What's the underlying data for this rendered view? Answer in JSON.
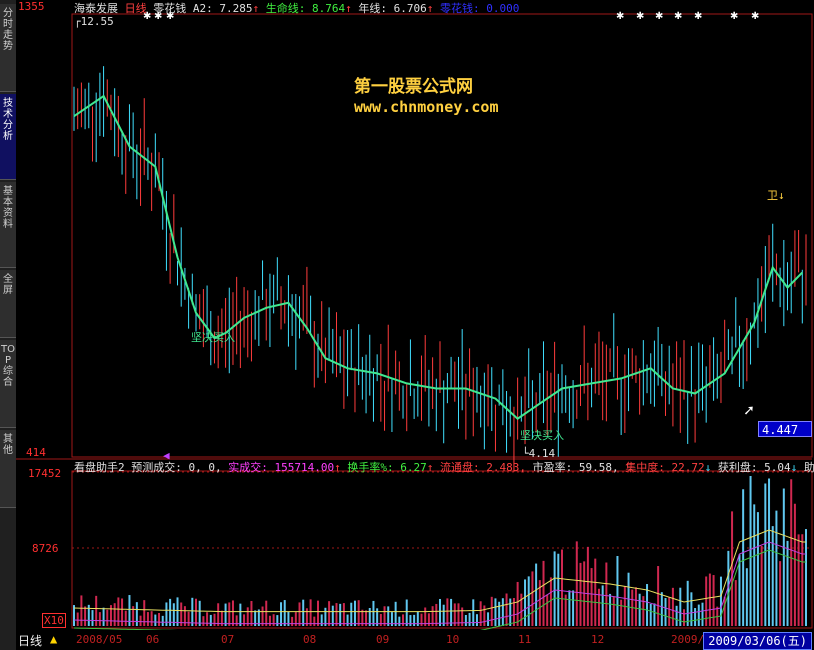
{
  "sidebar": {
    "tabs": [
      {
        "label": "分时走势",
        "active": false
      },
      {
        "label": "技术分析",
        "active": true
      },
      {
        "label": "基本资料",
        "active": false
      },
      {
        "label": "全屏",
        "active": false
      },
      {
        "label": "TOP综合",
        "active": false
      },
      {
        "label": "其他",
        "active": false
      }
    ]
  },
  "header": {
    "stock_name": "海泰发展",
    "period": "日线",
    "indicator": "零花钱",
    "a2_label": "A2:",
    "a2_value": "7.285",
    "life_label": "生命线:",
    "life_value": "8.764",
    "year_label": "年线:",
    "year_value": "6.706",
    "money_label": "零花钱:",
    "money_value": "0.000",
    "arrow_up": "↑",
    "axis_top_fragment": "1355"
  },
  "watermark": {
    "line1": "第一股票公式网",
    "line2": "www.chnmoney.com"
  },
  "price_panel": {
    "max_label": "12.55",
    "min_label": "4.14",
    "bottom_axis_label": "414",
    "signal_text": "坚决买入",
    "current_price": "4.447",
    "sell_mark": "卫↓"
  },
  "volume_header": {
    "name": "看盘助手2",
    "forecast_label": "预测成交:",
    "forecast_value": "0, 0,",
    "deal_label": "实成交:",
    "deal_value": "155714.00",
    "turnover_label": "换手率%:",
    "turnover_value": "6.27",
    "float_label": "流通盘:",
    "float_value": "2.483,",
    "pe_label": "市盈率:",
    "pe_value": "59.58,",
    "conc_label": "集中度:",
    "conc_value": "22.72",
    "profit_label": "获利盘:",
    "profit_value": "5.04",
    "assist_label": "助",
    "arrow_down": "↓"
  },
  "volume_panel": {
    "y_labels": [
      "17452",
      "8726"
    ],
    "unit_label": "X10"
  },
  "status_bar": {
    "period_button": "日线",
    "date": "2009/03/06(五)",
    "time_ticks": [
      "2008/05",
      "06",
      "07",
      "08",
      "09",
      "10",
      "11",
      "12",
      "2009/"
    ]
  },
  "colors": {
    "up": "#ff3c3c",
    "down": "#40e0ff",
    "ma": "#40e890",
    "vol_up": "#d02850",
    "vol_down": "#60c8f0",
    "accent": "#ffd040"
  },
  "chart_data": {
    "type": "candlestick",
    "title": "海泰发展 日线",
    "x_range": [
      "2008/05",
      "2009/03/06"
    ],
    "ylim": [
      4.14,
      12.55
    ],
    "volume_ylim": [
      0,
      17452
    ],
    "ma_series_name": "A2",
    "ma_points": [
      [
        0,
        10.8
      ],
      [
        8,
        11.2
      ],
      [
        15,
        10.2
      ],
      [
        22,
        9.8
      ],
      [
        28,
        8.0
      ],
      [
        33,
        6.9
      ],
      [
        38,
        6.4
      ],
      [
        41,
        6.5
      ],
      [
        46,
        6.8
      ],
      [
        52,
        7.0
      ],
      [
        58,
        7.1
      ],
      [
        63,
        6.6
      ],
      [
        68,
        6.0
      ],
      [
        74,
        5.8
      ],
      [
        82,
        5.7
      ],
      [
        90,
        5.5
      ],
      [
        98,
        5.4
      ],
      [
        106,
        5.4
      ],
      [
        114,
        5.2
      ],
      [
        120,
        4.8
      ],
      [
        126,
        5.1
      ],
      [
        132,
        5.4
      ],
      [
        140,
        5.5
      ],
      [
        148,
        5.6
      ],
      [
        156,
        5.8
      ],
      [
        162,
        5.4
      ],
      [
        168,
        5.3
      ],
      [
        176,
        5.7
      ],
      [
        184,
        6.7
      ],
      [
        189,
        7.8
      ],
      [
        193,
        7.4
      ],
      [
        197,
        7.7
      ]
    ],
    "ma_x_max": 198,
    "signals": [
      {
        "text": "坚决买入",
        "x_index": 40,
        "price": 6.3
      },
      {
        "text": "坚决买入",
        "x_index": 122,
        "price": 4.2
      }
    ],
    "volume_profile": [
      [
        0,
        0.15
      ],
      [
        40,
        0.12
      ],
      [
        70,
        0.12
      ],
      [
        95,
        0.12
      ],
      [
        110,
        0.13
      ],
      [
        120,
        0.2
      ],
      [
        130,
        0.4
      ],
      [
        145,
        0.35
      ],
      [
        155,
        0.3
      ],
      [
        165,
        0.2
      ],
      [
        175,
        0.25
      ],
      [
        180,
        0.7
      ],
      [
        188,
        0.8
      ],
      [
        197,
        0.7
      ]
    ]
  }
}
